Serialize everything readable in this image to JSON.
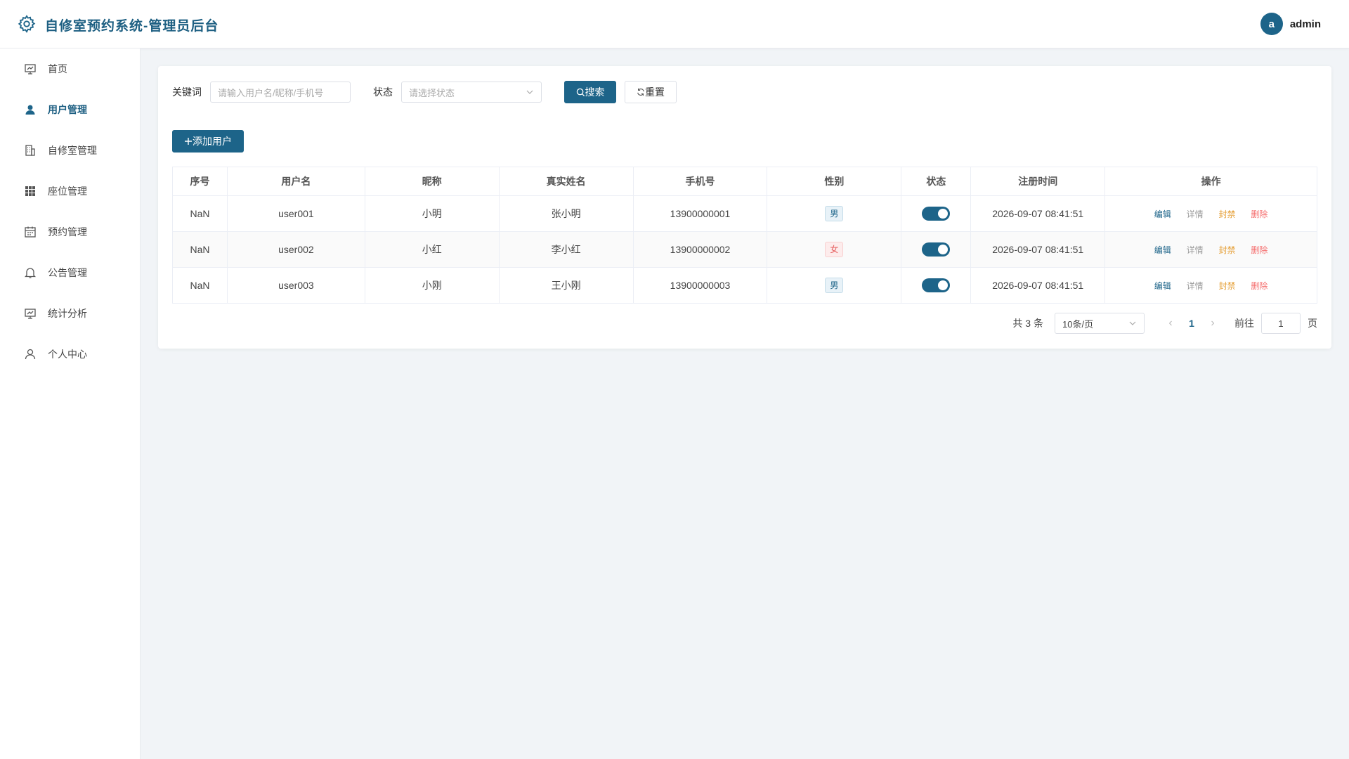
{
  "header": {
    "title": "自修室预约系统-管理员后台",
    "avatar_letter": "a",
    "username": "admin"
  },
  "sidebar": {
    "items": [
      {
        "label": "首页",
        "icon": "dashboard-icon"
      },
      {
        "label": "用户管理",
        "icon": "user-icon",
        "active": true
      },
      {
        "label": "自修室管理",
        "icon": "building-icon"
      },
      {
        "label": "座位管理",
        "icon": "grid-icon"
      },
      {
        "label": "预约管理",
        "icon": "calendar-icon"
      },
      {
        "label": "公告管理",
        "icon": "bell-icon"
      },
      {
        "label": "统计分析",
        "icon": "chart-icon"
      },
      {
        "label": "个人中心",
        "icon": "person-icon"
      }
    ]
  },
  "filters": {
    "keyword_label": "关键词",
    "keyword_placeholder": "请输入用户名/昵称/手机号",
    "status_label": "状态",
    "status_placeholder": "请选择状态",
    "search_label": "搜索",
    "reset_label": "重置"
  },
  "add_button_label": "添加用户",
  "table": {
    "headers": [
      "序号",
      "用户名",
      "昵称",
      "真实姓名",
      "手机号",
      "性别",
      "状态",
      "注册时间",
      "操作"
    ],
    "rows": [
      {
        "index": "NaN",
        "username": "user001",
        "nickname": "小明",
        "realname": "张小明",
        "phone": "13900000001",
        "gender": "男",
        "enabled": true,
        "registered": "2026-09-07 08:41:51"
      },
      {
        "index": "NaN",
        "username": "user002",
        "nickname": "小红",
        "realname": "李小红",
        "phone": "13900000002",
        "gender": "女",
        "enabled": true,
        "registered": "2026-09-07 08:41:51"
      },
      {
        "index": "NaN",
        "username": "user003",
        "nickname": "小刚",
        "realname": "王小刚",
        "phone": "13900000003",
        "gender": "男",
        "enabled": true,
        "registered": "2026-09-07 08:41:51"
      }
    ],
    "actions": {
      "edit": "编辑",
      "detail": "详情",
      "ban": "封禁",
      "delete": "删除"
    }
  },
  "pagination": {
    "total_text": "共 3 条",
    "page_size": "10条/页",
    "current_page": "1",
    "goto_label": "前往",
    "goto_value": "1",
    "page_suffix": "页"
  },
  "colors": {
    "primary": "#1d6489",
    "warning": "#e6a23c",
    "danger": "#f56c6c"
  }
}
